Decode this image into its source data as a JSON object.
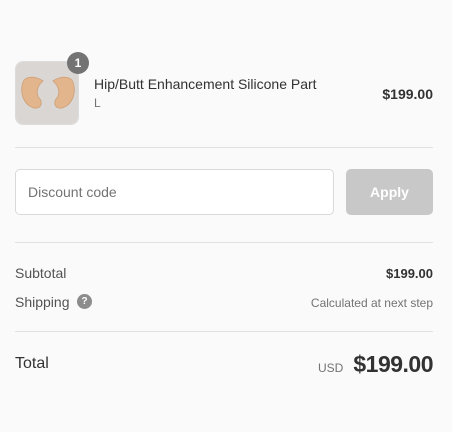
{
  "cart": {
    "item": {
      "quantity": "1",
      "name": "Hip/Butt Enhancement Silicone Part",
      "variant": "L",
      "price": "$199.00",
      "image_icon": "silicone-pad-thumbnail"
    }
  },
  "discount": {
    "placeholder": "Discount code",
    "value": "",
    "apply_label": "Apply"
  },
  "totals": {
    "subtotal_label": "Subtotal",
    "subtotal_value": "$199.00",
    "shipping_label": "Shipping",
    "shipping_help_icon": "question-mark-icon",
    "shipping_value": "Calculated at next step",
    "total_label": "Total",
    "currency": "USD",
    "total_value": "$199.00"
  },
  "colors": {
    "background": "#fafafa",
    "divider": "#e1e1e1",
    "badge": "#737373",
    "apply_disabled": "#c8c8c8",
    "product_skin": "#e2b58c"
  }
}
